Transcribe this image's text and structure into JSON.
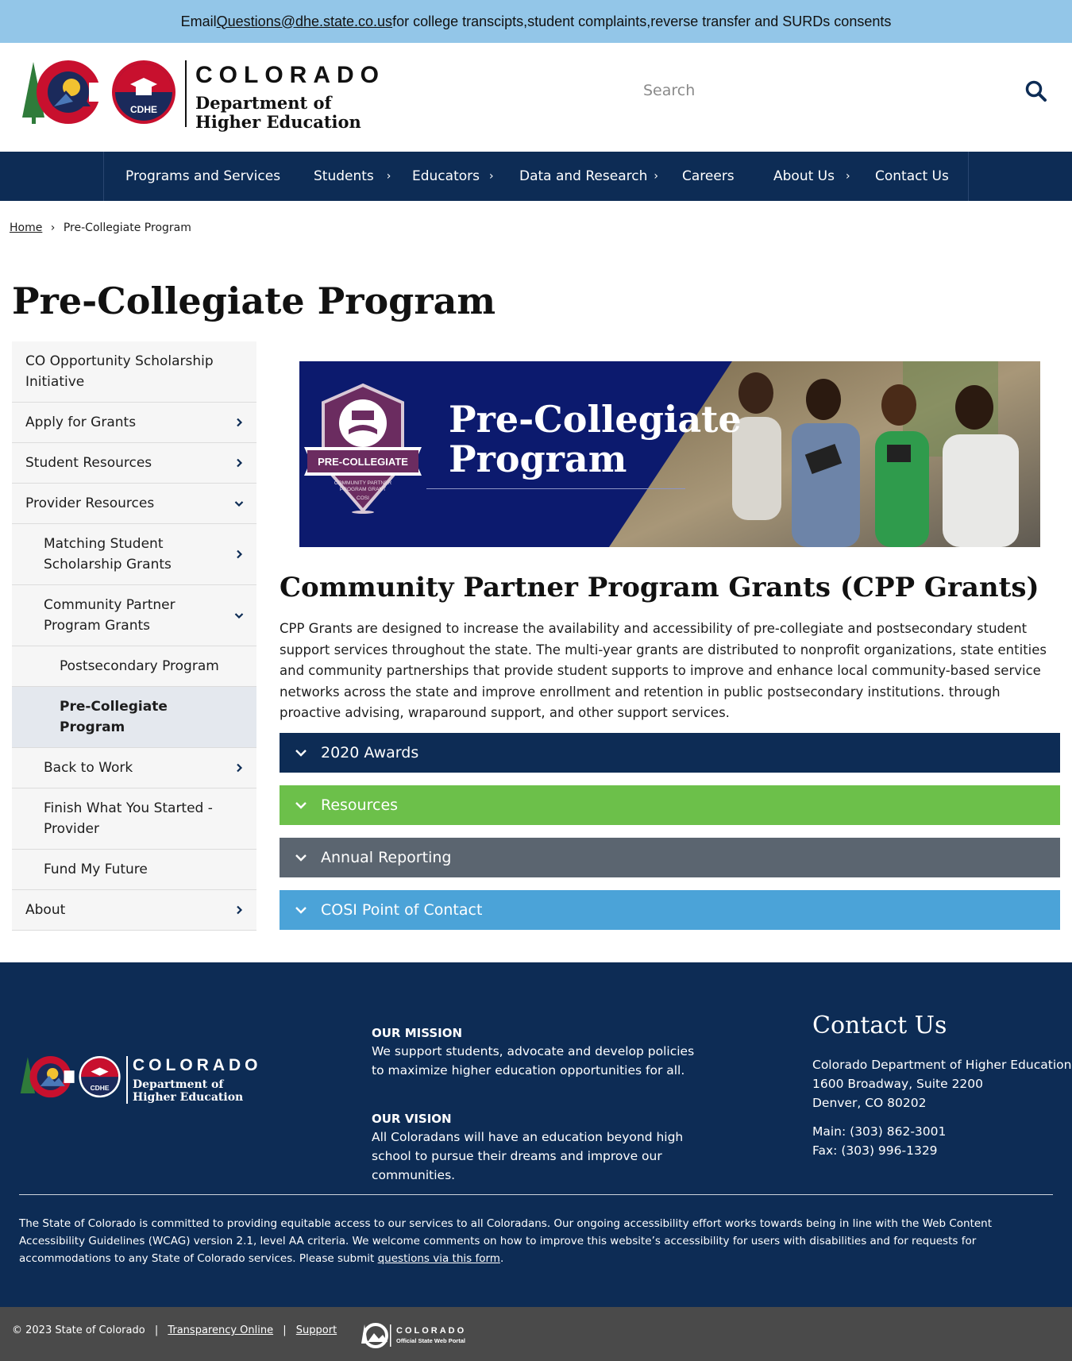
{
  "alert": {
    "prefix": "Email ",
    "email": "Questions@dhe.state.co.us",
    "suffix": " for college transcipts,student complaints,reverse transfer and SURDs consents"
  },
  "header": {
    "logo_colorado": "COLORADO",
    "logo_dept_line1": "Department of",
    "logo_dept_line2": "Higher Education",
    "logo_badge": "CDHE",
    "search_placeholder": "Search",
    "search_icon": "search-icon"
  },
  "nav": {
    "items": [
      {
        "label": "Programs and Services",
        "chevron": false
      },
      {
        "label": "Students",
        "chevron": true
      },
      {
        "label": "Educators",
        "chevron": true
      },
      {
        "label": "Data and Research",
        "chevron": true
      },
      {
        "label": "Careers",
        "chevron": false
      },
      {
        "label": "About Us",
        "chevron": true
      },
      {
        "label": "Contact Us",
        "chevron": false
      }
    ],
    "chevron_glyph": "›"
  },
  "breadcrumb": {
    "home": "Home",
    "separator": "›",
    "current": "Pre-Collegiate Program"
  },
  "page_title": "Pre-Collegiate Program",
  "sidebar": {
    "items": [
      {
        "label": "CO Opportunity Scholarship Initiative",
        "level": 1,
        "chevron": "none"
      },
      {
        "label": "Apply for Grants",
        "level": 1,
        "chevron": "right"
      },
      {
        "label": "Student Resources",
        "level": 1,
        "chevron": "right"
      },
      {
        "label": "Provider Resources",
        "level": 1,
        "chevron": "down"
      },
      {
        "label": "Matching Student Scholarship Grants",
        "level": 2,
        "chevron": "right"
      },
      {
        "label": "Community Partner Program Grants",
        "level": 2,
        "chevron": "down"
      },
      {
        "label": "Postsecondary Program",
        "level": 3,
        "chevron": "none"
      },
      {
        "label": "Pre-Collegiate Program",
        "level": 3,
        "chevron": "none",
        "active": true
      },
      {
        "label": "Back to Work",
        "level": 2,
        "chevron": "right"
      },
      {
        "label": "Finish What You Started - Provider",
        "level": 2,
        "chevron": "none"
      },
      {
        "label": "Fund My Future",
        "level": 2,
        "chevron": "none"
      },
      {
        "label": "About",
        "level": 1,
        "chevron": "right"
      }
    ]
  },
  "banner": {
    "badge_title": "PRE-COLLEGIATE",
    "badge_sub1": "COMMUNITY PARTNER",
    "badge_sub2": "PROGRAM GRANT",
    "badge_sub3": "COSI",
    "title_line1": "Pre-Collegiate",
    "title_line2": "Program",
    "background_color": "#0c1a6e"
  },
  "main": {
    "section_title": "Community Partner Program Grants (CPP Grants)",
    "body": "CPP Grants are designed to increase the availability and accessibility of pre-collegiate and postsecondary student support services throughout the state. The multi-year grants are distributed to nonprofit organizations, state entities and community partnerships that provide student supports to improve and enhance local community-based service networks across the state and improve enrollment and retention in public postsecondary institutions. through proactive advising, wraparound support, and other support services.",
    "accordions": [
      {
        "label": "2020 Awards",
        "color": "#0d2c55"
      },
      {
        "label": "Resources",
        "color": "#6cc04a"
      },
      {
        "label": "Annual Reporting",
        "color": "#5b6570"
      },
      {
        "label": "COSI Point of Contact",
        "color": "#4ba3d8"
      }
    ]
  },
  "footer": {
    "logo_colorado": "COLORADO",
    "logo_dept_line1": "Department of",
    "logo_dept_line2": "Higher Education",
    "logo_badge": "CDHE",
    "mission_heading": "OUR MISSION",
    "mission_text": "We support students, advocate and develop policies to maximize higher education opportunities for all.",
    "vision_heading": "OUR VISION",
    "vision_text": "All Coloradans will have an education beyond high school to pursue their dreams and improve our communities.",
    "contact_title": "Contact Us",
    "address_line1": "Colorado Department of Higher Education",
    "address_line2": "1600 Broadway, Suite 2200",
    "address_line3": "Denver, CO 80202",
    "main_phone": "Main: (303) 862-3001",
    "fax": "Fax: (303) 996-1329",
    "accessibility_text": "The State of Colorado is committed to providing equitable access to our services to all Coloradans. Our ongoing accessibility effort works towards being in line with the Web Content Accessibility Guidelines (WCAG) version 2.1, level AA criteria. We welcome comments on how to improve this website’s accessibility for users with disabilities and for requests for accommodations to any State of Colorado services. Please submit ",
    "accessibility_link": "questions via this form",
    "accessibility_end": ".",
    "background_color": "#0d2c55"
  },
  "bottom_bar": {
    "copyright": "© 2023 State of Colorado",
    "separator": "|",
    "transparency": "Transparency Online",
    "support": "Support",
    "portal_colorado": "COLORADO",
    "portal_sub": "Official State Web Portal"
  }
}
